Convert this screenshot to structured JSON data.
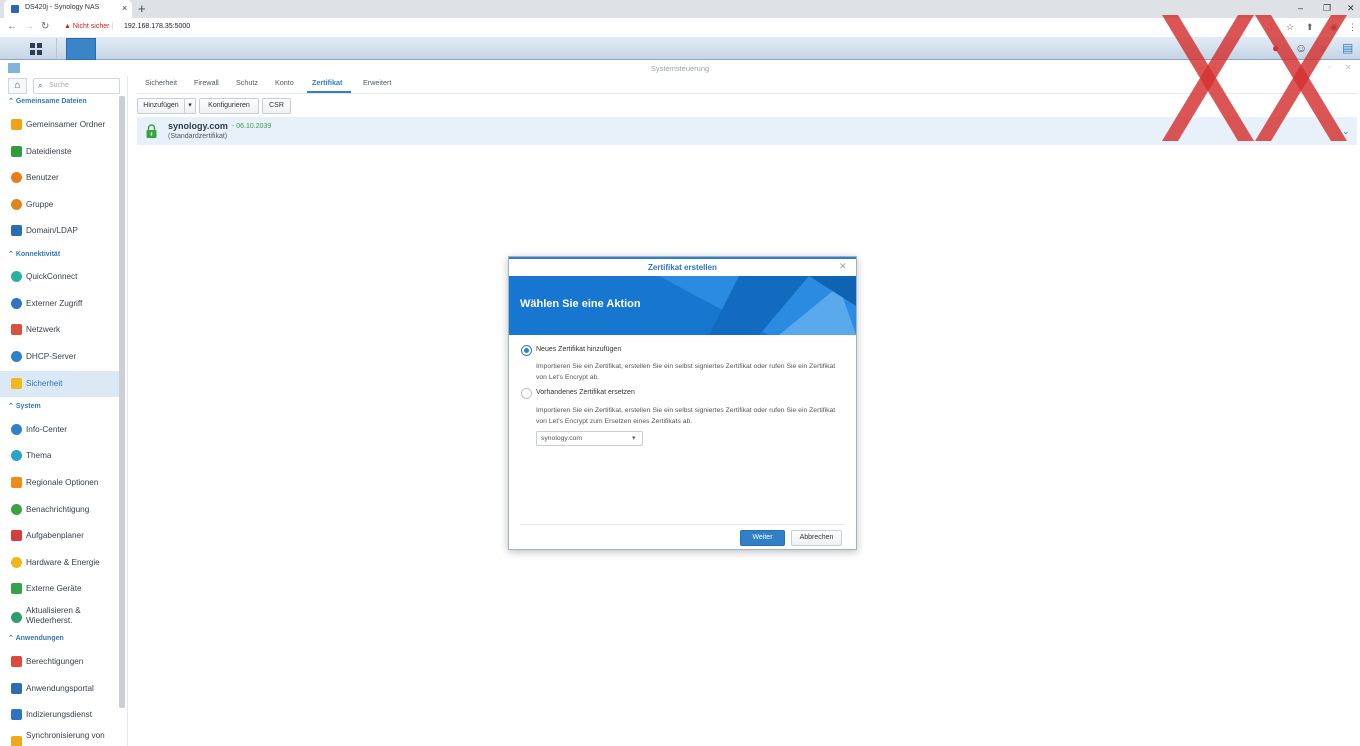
{
  "browser": {
    "tab_title": "DS420j - Synology NAS",
    "tab_close": "×",
    "new_tab": "+",
    "insecure_label": "Nicht sicher",
    "url": "192.168.178.35:5000",
    "min": "–",
    "restore": "❐",
    "close": "✕"
  },
  "window": {
    "title": "Systemsteuerung"
  },
  "search": {
    "placeholder": "Suche"
  },
  "sidebar": {
    "sections": [
      {
        "label": "Gemeinsame Dateien"
      },
      {
        "label": "Konnektivität"
      },
      {
        "label": "System"
      },
      {
        "label": "Anwendungen"
      }
    ],
    "items": [
      {
        "label": "Gemeinsamer Ordner",
        "color": "#f2a313"
      },
      {
        "label": "Dateidienste",
        "color": "#2e9c3f"
      },
      {
        "label": "Benutzer",
        "color": "#e87b1c"
      },
      {
        "label": "Gruppe",
        "color": "#e0851d"
      },
      {
        "label": "Domain/LDAP",
        "color": "#2a6db5"
      },
      {
        "label": "QuickConnect",
        "color": "#2db0a4"
      },
      {
        "label": "Externer Zugriff",
        "color": "#2f73c2"
      },
      {
        "label": "Netzwerk",
        "color": "#d9503f"
      },
      {
        "label": "DHCP-Server",
        "color": "#2f80c7"
      },
      {
        "label": "Sicherheit",
        "color": "#f0b81b"
      },
      {
        "label": "Info-Center",
        "color": "#2f80c7"
      },
      {
        "label": "Thema",
        "color": "#29a3c7"
      },
      {
        "label": "Regionale Optionen",
        "color": "#f08b1d"
      },
      {
        "label": "Benachrichtigung",
        "color": "#3aa340"
      },
      {
        "label": "Aufgabenplaner",
        "color": "#d63d3d"
      },
      {
        "label": "Hardware & Energie",
        "color": "#f2b51b"
      },
      {
        "label": "Externe Geräte",
        "color": "#35a24a"
      },
      {
        "label": "Aktualisieren &",
        "label2": "Wiederherst.",
        "color": "#2f9c6e"
      },
      {
        "label": "Berechtigungen",
        "color": "#e04a3b"
      },
      {
        "label": "Anwendungsportal",
        "color": "#2a6db5"
      },
      {
        "label": "Indizierungsdienst",
        "color": "#2f73c2"
      },
      {
        "label": "Synchronisierung von",
        "color": "#f0a81b"
      }
    ]
  },
  "tabs": [
    "Sicherheit",
    "Firewall",
    "Schutz",
    "Konto",
    "Zertifikat",
    "Erweitert"
  ],
  "toolbar": {
    "add": "Hinzufügen",
    "configure": "Konfigurieren",
    "csr": "CSR"
  },
  "certificate": {
    "name": "synology.com",
    "date_prefix": "- ",
    "date": "06.10.2039",
    "subtitle": "(Standardzertifikat)"
  },
  "dialog": {
    "title": "Zertifikat erstellen",
    "heading": "Wählen Sie eine Aktion",
    "option1": "Neues Zertifikat hinzufügen",
    "option1_desc": "Importieren Sie ein Zertifikat, erstellen Sie ein selbst signiertes Zertifikat oder rufen Sie ein Zertifikat von Let's Encrypt ab.",
    "option2": "Vorhandenes Zertifikat ersetzen",
    "option2_desc": "Importieren Sie ein Zertifikat, erstellen Sie ein selbst signiertes Zertifikat oder rufen Sie ein Zertifikat von Let's Encrypt zum Ersetzen eines Zertifikats ab.",
    "select_value": "synology.com",
    "next": "Weiter",
    "cancel": "Abbrechen",
    "selected_option": 1
  },
  "colors": {
    "accent": "#2f80c7",
    "watermark": "#d32f2f"
  }
}
